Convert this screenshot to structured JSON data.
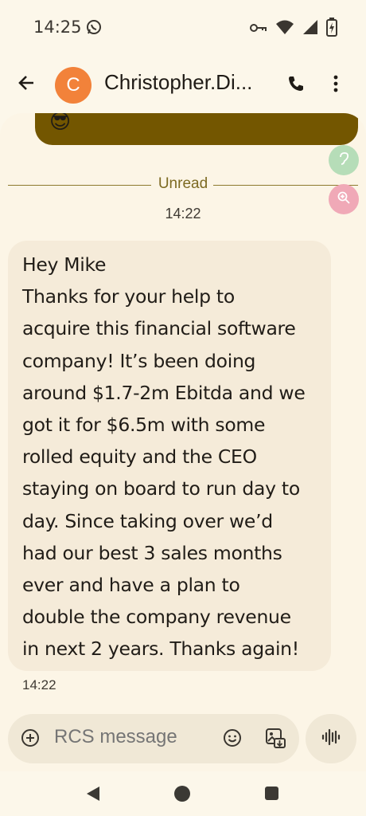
{
  "status_bar": {
    "time": "14:25",
    "icons": [
      "whatsapp-icon",
      "vpn-key-icon",
      "wifi-icon",
      "signal-icon",
      "battery-charging-icon"
    ]
  },
  "header": {
    "avatar_letter": "C",
    "contact_name": "Christopher.Di...",
    "avatar_color": "#F2823A",
    "icons": [
      "back-arrow-icon",
      "phone-icon",
      "more-vert-icon"
    ]
  },
  "conversation": {
    "sent_bubble_emoji": "😎",
    "sent_bubble_color": "#735600",
    "unread_label": "Unread",
    "divider_time": "14:22",
    "message": {
      "text": "Hey Mike\nThanks for your help to\nacquire this financial software\ncompany! It’s been doing\naround $1.7-2m Ebitda and we\ngot it for $6.5m with some\nrolled equity and the CEO\nstaying on board to run day to\nday. Since taking over we’d\nhad our best 3 sales months\never and have a plan to\ndouble the company revenue\nin next 2 years. Thanks again!",
      "time": "14:22"
    }
  },
  "floating_buttons": [
    {
      "name": "hearing-icon",
      "color": "#B6DDB8"
    },
    {
      "name": "zoom-icon",
      "color": "#F0A9B7"
    }
  ],
  "composer": {
    "placeholder": "RCS message",
    "value": "",
    "icons": [
      "add-circle-icon",
      "emoji-icon",
      "gallery-icon",
      "voice-icon"
    ]
  },
  "nav_bar": {
    "icons": [
      "nav-back-icon",
      "nav-home-icon",
      "nav-recents-icon"
    ]
  }
}
